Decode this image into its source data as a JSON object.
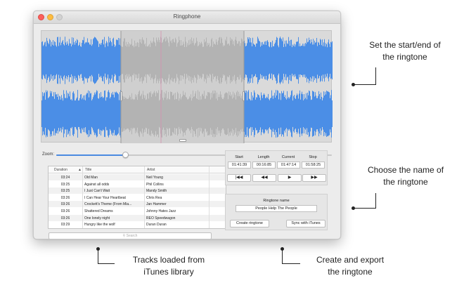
{
  "window": {
    "title": "Ringphone"
  },
  "waveform": {
    "wave_color": "#4b8ee6",
    "selected_wave_color": "#b3b3b3",
    "selection_overlay_color": "#cfcfcf",
    "handle_icon": "grip-icon"
  },
  "zoom": {
    "label": "Zoom:",
    "level": 0.25
  },
  "tracks": {
    "columns": {
      "duration": "Duration",
      "title": "Title",
      "artist": "Artist"
    },
    "sort_icon": "sort-ascending-icon",
    "rows": [
      {
        "duration": "03:24",
        "title": "Old Man",
        "artist": "Neil Young"
      },
      {
        "duration": "03:25",
        "title": "Against all odds",
        "artist": "Phil Collins"
      },
      {
        "duration": "03:25",
        "title": "I Just Can't Wait",
        "artist": "Mandy Smith"
      },
      {
        "duration": "03:26",
        "title": "I Can Hear Your Heartbeat",
        "artist": "Chris Rea"
      },
      {
        "duration": "03:26",
        "title": "Crockett's Theme (From Mia...",
        "artist": "Jan Hammer"
      },
      {
        "duration": "03:26",
        "title": "Shattered Dreams",
        "artist": "Johnny Hates Jazz"
      },
      {
        "duration": "03:26",
        "title": "One lonely night",
        "artist": "REO Speedwagon"
      },
      {
        "duration": "03:29",
        "title": "Hungry like the wolf",
        "artist": "Duran Duran"
      }
    ],
    "search_placeholder": "Search",
    "search_icon": "magnifier-icon"
  },
  "timing": {
    "start_label": "Start",
    "start_value": "01:41:39",
    "length_label": "Length",
    "length_value": "00:16:85",
    "current_label": "Current",
    "current_value": "01:47:14",
    "stop_label": "Stop",
    "stop_value": "01:58:25",
    "buttons": {
      "skip_back": "|◀◀",
      "rewind": "◀◀",
      "play": "▶",
      "fast_forward": "▶▶"
    }
  },
  "export": {
    "name_label": "Ringtone name",
    "name_value": "People Help The People",
    "create_button": "Create ringtone",
    "sync_button": "Sync with iTunes"
  },
  "annotations": {
    "set_start_end": [
      "Set the start/end of",
      "the ringtone"
    ],
    "choose_name": [
      "Choose the name of",
      "the ringtone"
    ],
    "tracks_loaded": [
      "Tracks loaded from",
      "iTunes library"
    ],
    "create_export": [
      "Create and export",
      "the ringtone"
    ]
  }
}
